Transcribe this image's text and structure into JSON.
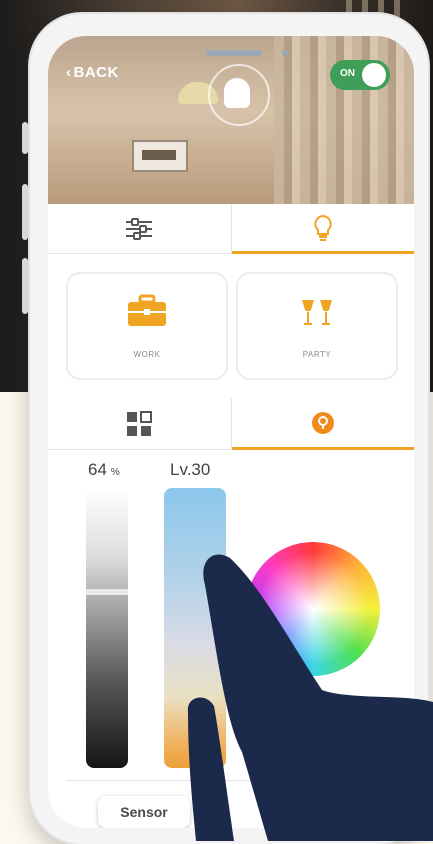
{
  "header": {
    "back_label": "BACK",
    "power_toggle": {
      "label": "ON",
      "state": "on"
    }
  },
  "tabs_top": [
    {
      "icon": "sliders-icon",
      "active": false
    },
    {
      "icon": "bulb-icon",
      "active": true
    }
  ],
  "scenes": [
    {
      "label": "WORK",
      "icon": "briefcase-icon"
    },
    {
      "label": "PARTY",
      "icon": "cheers-icon"
    }
  ],
  "tabs_mode": [
    {
      "icon": "grid-icon",
      "active": false
    },
    {
      "icon": "color-pin-icon",
      "active": true
    }
  ],
  "brightness": {
    "value": "64",
    "unit": "%",
    "level": 0.64
  },
  "color_temperature": {
    "label": "Lv.30"
  },
  "footer": {
    "sensor_label": "Sensor"
  },
  "colors": {
    "accent": "#f0a424",
    "toggle_on": "#3f9e57",
    "hand": "#1b2a4a"
  }
}
